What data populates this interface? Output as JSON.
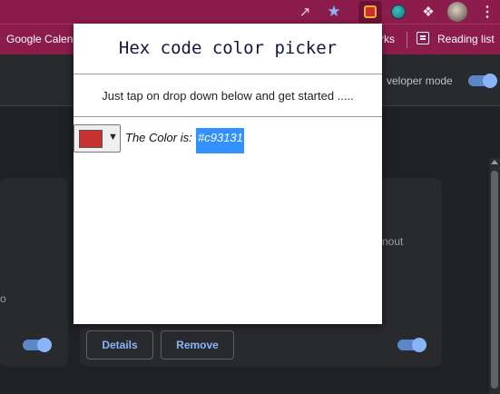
{
  "browser": {
    "icons": {
      "share": "share-icon",
      "bookmark_star": "star-icon",
      "active_extension": "color-picker-extension-icon",
      "other_extension": "globe-extension-icon",
      "extensions": "puzzle-icon",
      "profile": "avatar",
      "menu": "kebab-menu-icon"
    },
    "bookmarks": {
      "calendar_label": "Google Calend",
      "bookmarks_fragment": "rks",
      "reading_list_label": "Reading list"
    },
    "theme_color": "#8c1c4c"
  },
  "page": {
    "developer_mode_label": "veloper mode",
    "card_left_fragment": "o",
    "card_right_fragment": "nout",
    "details_label": "Details",
    "remove_label": "Remove",
    "accent_color": "#8ab4f8"
  },
  "popup": {
    "title": "Hex code color picker",
    "instruction": "Just tap on drop down below and get started .....",
    "color_prefix": "The Color is:",
    "hex_value": "#c93131",
    "selected_color": "#c93131",
    "dropdown_glyph": "▼"
  }
}
